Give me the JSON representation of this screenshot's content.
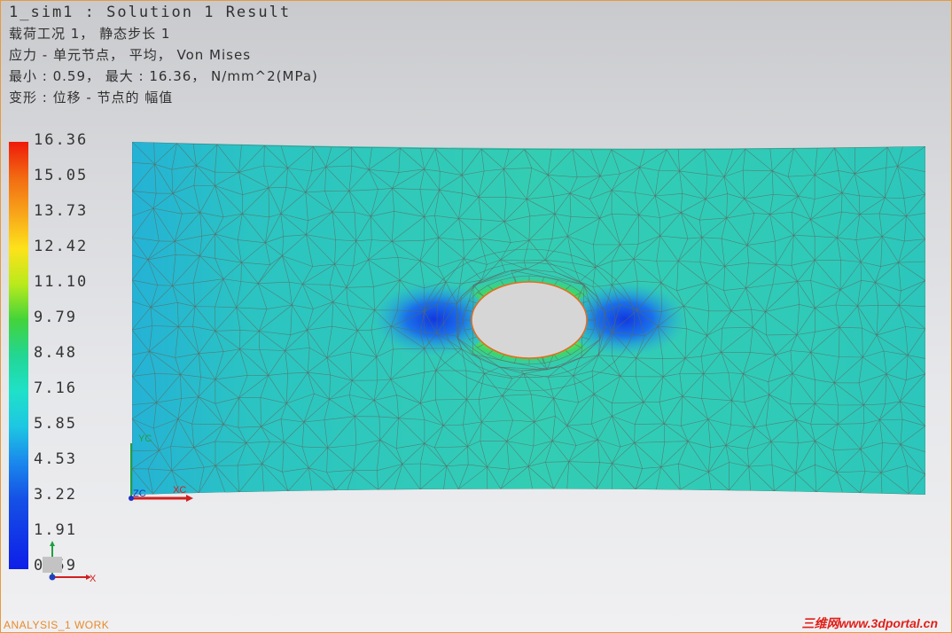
{
  "header": {
    "line1": "1_sim1 : Solution 1 Result",
    "line2": "载荷工况 1， 静态步长 1",
    "line3": "应力 - 单元节点， 平均， Von Mises",
    "line4": "最小 : 0.59， 最大 : 16.36， N/mm^2(MPa)",
    "line5": "变形 : 位移 - 节点的 幅值"
  },
  "legend": {
    "ticks": [
      "16.36",
      "15.05",
      "13.73",
      "12.42",
      "11.10",
      "9.79",
      "8.48",
      "7.16",
      "5.85",
      "4.53",
      "3.22",
      "1.91",
      "0.59"
    ],
    "colors": [
      "#ee1a0a",
      "#f26a12",
      "#f8a41a",
      "#fde21b",
      "#b9ea1c",
      "#43d43a",
      "#22d693",
      "#1fe1c8",
      "#1dc7e2",
      "#1a88ec",
      "#1552e6",
      "#0e1ee8"
    ]
  },
  "triad": {
    "model_x": "XC",
    "model_z": "ZC",
    "model_y": "YC",
    "wcs_x": "X"
  },
  "status": {
    "text": "ANALYSIS_1 WORK"
  },
  "watermark": {
    "text": "三维网www.3dportal.cn"
  },
  "colors": {
    "plate_base": "#30c8b8",
    "mesh_line": "#5a6a60",
    "hole_fill": "#d6d6d6",
    "status": "#e88a2a",
    "accent": "#e89a3c"
  }
}
